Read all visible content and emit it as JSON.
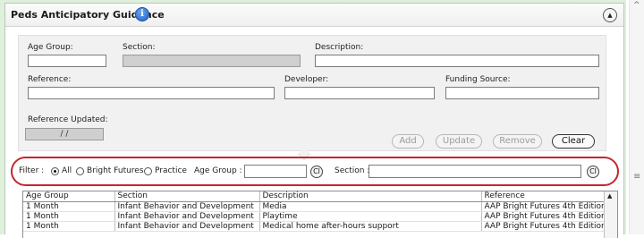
{
  "panel": {
    "title": "Peds Anticipatory Guidance",
    "info_icon": "i",
    "collapse_icon": "▲"
  },
  "form": {
    "age_group_label": "Age Group:",
    "age_group_value": "",
    "section_label": "Section:",
    "section_value": "",
    "description_label": "Description:",
    "description_value": "",
    "reference_label": "Reference:",
    "reference_value": "",
    "developer_label": "Developer:",
    "developer_value": "",
    "funding_label": "Funding Source:",
    "funding_value": "",
    "ref_updated_label": "Reference Updated:",
    "ref_updated_value": "/ /",
    "buttons": {
      "add": "Add",
      "update": "Update",
      "remove": "Remove",
      "clear": "Clear"
    }
  },
  "filter": {
    "label": "Filter :",
    "options": [
      "All",
      "Bright Futures",
      "Practice"
    ],
    "selected": "All",
    "age_group_label": "Age Group :",
    "age_group_value": "",
    "section_label": "Section :",
    "section_value": "",
    "clear_glyph": "Cl"
  },
  "grid": {
    "columns": [
      "Age Group",
      "Section",
      "Description",
      "Reference"
    ],
    "rows": [
      [
        "1 Month",
        "Infant Behavior and Development",
        "Media",
        "AAP Bright Futures 4th Edition"
      ],
      [
        "1 Month",
        "Infant Behavior and Development",
        "Playtime",
        "AAP Bright Futures 4th Edition"
      ],
      [
        "1 Month",
        "Infant Behavior and Development",
        "Medical home after-hours support",
        "AAP Bright Futures 4th Edition"
      ]
    ]
  },
  "scrollbar": {
    "up_arrow": "^",
    "grip": "≡"
  },
  "colors": {
    "highlight": "#c4262e",
    "page_bg": "#dff0dc",
    "info": "#1f5fc4"
  }
}
